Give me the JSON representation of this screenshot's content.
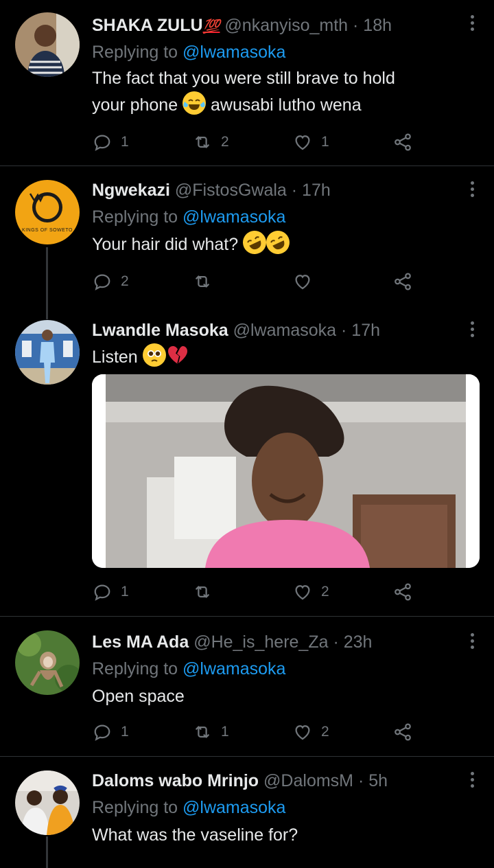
{
  "tweets": [
    {
      "name": "SHAKA ZULU",
      "name_badge": "💯",
      "handle": "@nkanyiso_mth",
      "time": "18h",
      "replying_prefix": "Replying to",
      "replying_to": "@lwamasoka",
      "text_line1": "The fact that you were still brave to hold",
      "text_line2a": "your phone",
      "text_line2b": "awusabi lutho wena",
      "counts": {
        "reply": "1",
        "retweet": "2",
        "like": "1"
      }
    },
    {
      "name": "Ngwekazi",
      "handle": "@FistosGwala",
      "time": "17h",
      "replying_prefix": "Replying to",
      "replying_to": "@lwamasoka",
      "text": "Your hair did what?",
      "avatar_text": "KINGS OF SOWETO",
      "counts": {
        "reply": "2",
        "retweet": "",
        "like": ""
      }
    },
    {
      "name": "Lwandle Masoka",
      "handle": "@lwamasoka",
      "time": "17h",
      "text": "Listen",
      "counts": {
        "reply": "1",
        "retweet": "",
        "like": "2"
      }
    },
    {
      "name": "Les MA Ada",
      "handle": "@He_is_here_Za",
      "time": "23h",
      "replying_prefix": "Replying to",
      "replying_to": "@lwamasoka",
      "text": "Open space",
      "counts": {
        "reply": "1",
        "retweet": "1",
        "like": "2"
      }
    },
    {
      "name": "Daloms wabo Mrinjo",
      "handle": "@DalomsM",
      "time": "5h",
      "replying_prefix": "Replying to",
      "replying_to": "@lwamasoka",
      "text": "What was the vaseline for?"
    }
  ],
  "separator": "·",
  "colors": {
    "background": "#000000",
    "text": "#e7e9ea",
    "muted": "#71767b",
    "link": "#1d9bf0",
    "divider": "#2f3336"
  }
}
